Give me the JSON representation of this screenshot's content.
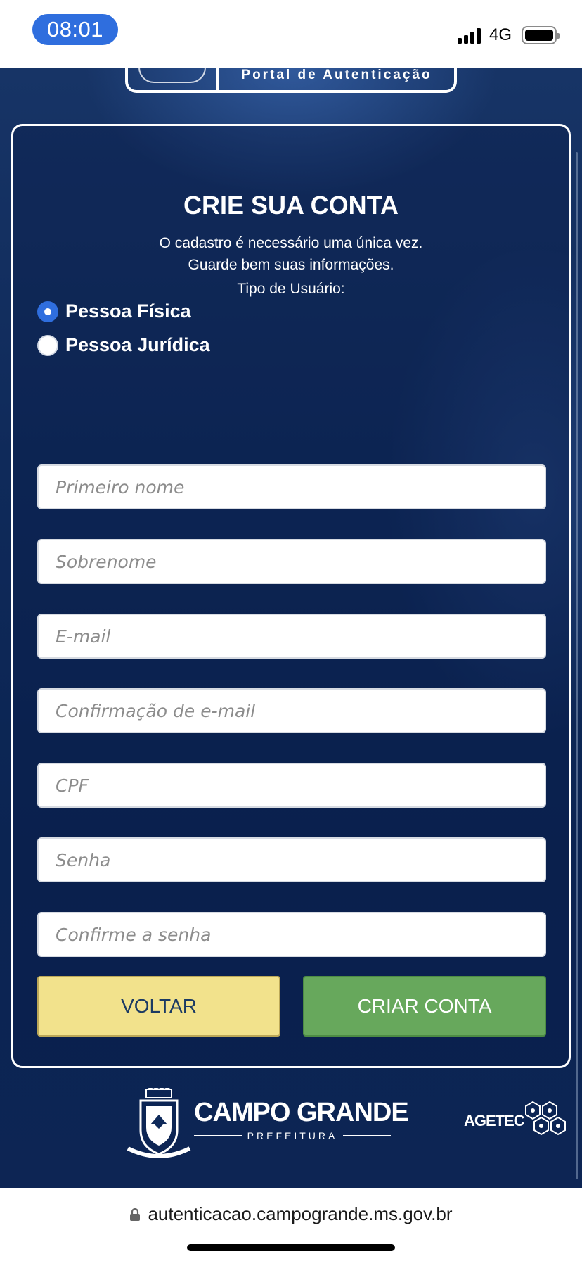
{
  "status_bar": {
    "time": "08:01",
    "network": "4G"
  },
  "header": {
    "portal_title": "Portal de Autenticação"
  },
  "form": {
    "title": "CRIE SUA CONTA",
    "subtitle_line1": "O cadastro é necessário uma única vez.",
    "subtitle_line2": "Guarde bem suas informações.",
    "user_type_label": "Tipo de Usuário:",
    "user_types": [
      {
        "label": "Pessoa Física",
        "selected": true
      },
      {
        "label": "Pessoa Jurídica",
        "selected": false
      }
    ],
    "fields": {
      "first_name": {
        "placeholder": "Primeiro nome",
        "value": ""
      },
      "last_name": {
        "placeholder": "Sobrenome",
        "value": ""
      },
      "email": {
        "placeholder": "E-mail",
        "value": ""
      },
      "email_confirm": {
        "placeholder": "Confirmação de e-mail",
        "value": ""
      },
      "cpf": {
        "placeholder": "CPF",
        "value": ""
      },
      "password": {
        "placeholder": "Senha",
        "value": ""
      },
      "password_confirm": {
        "placeholder": "Confirme a senha",
        "value": ""
      }
    },
    "back_label": "VOLTAR",
    "create_label": "CRIAR CONTA"
  },
  "footer": {
    "city_name": "CAMPO GRANDE",
    "city_sub": "PREFEITURA",
    "agency": "AGETEC"
  },
  "browser": {
    "url": "autenticacao.campogrande.ms.gov.br"
  },
  "colors": {
    "accent_blue": "#2f6ede",
    "back_button": "#f2e28c",
    "create_button": "#67a85c",
    "background_navy": "#0f2a5a"
  }
}
